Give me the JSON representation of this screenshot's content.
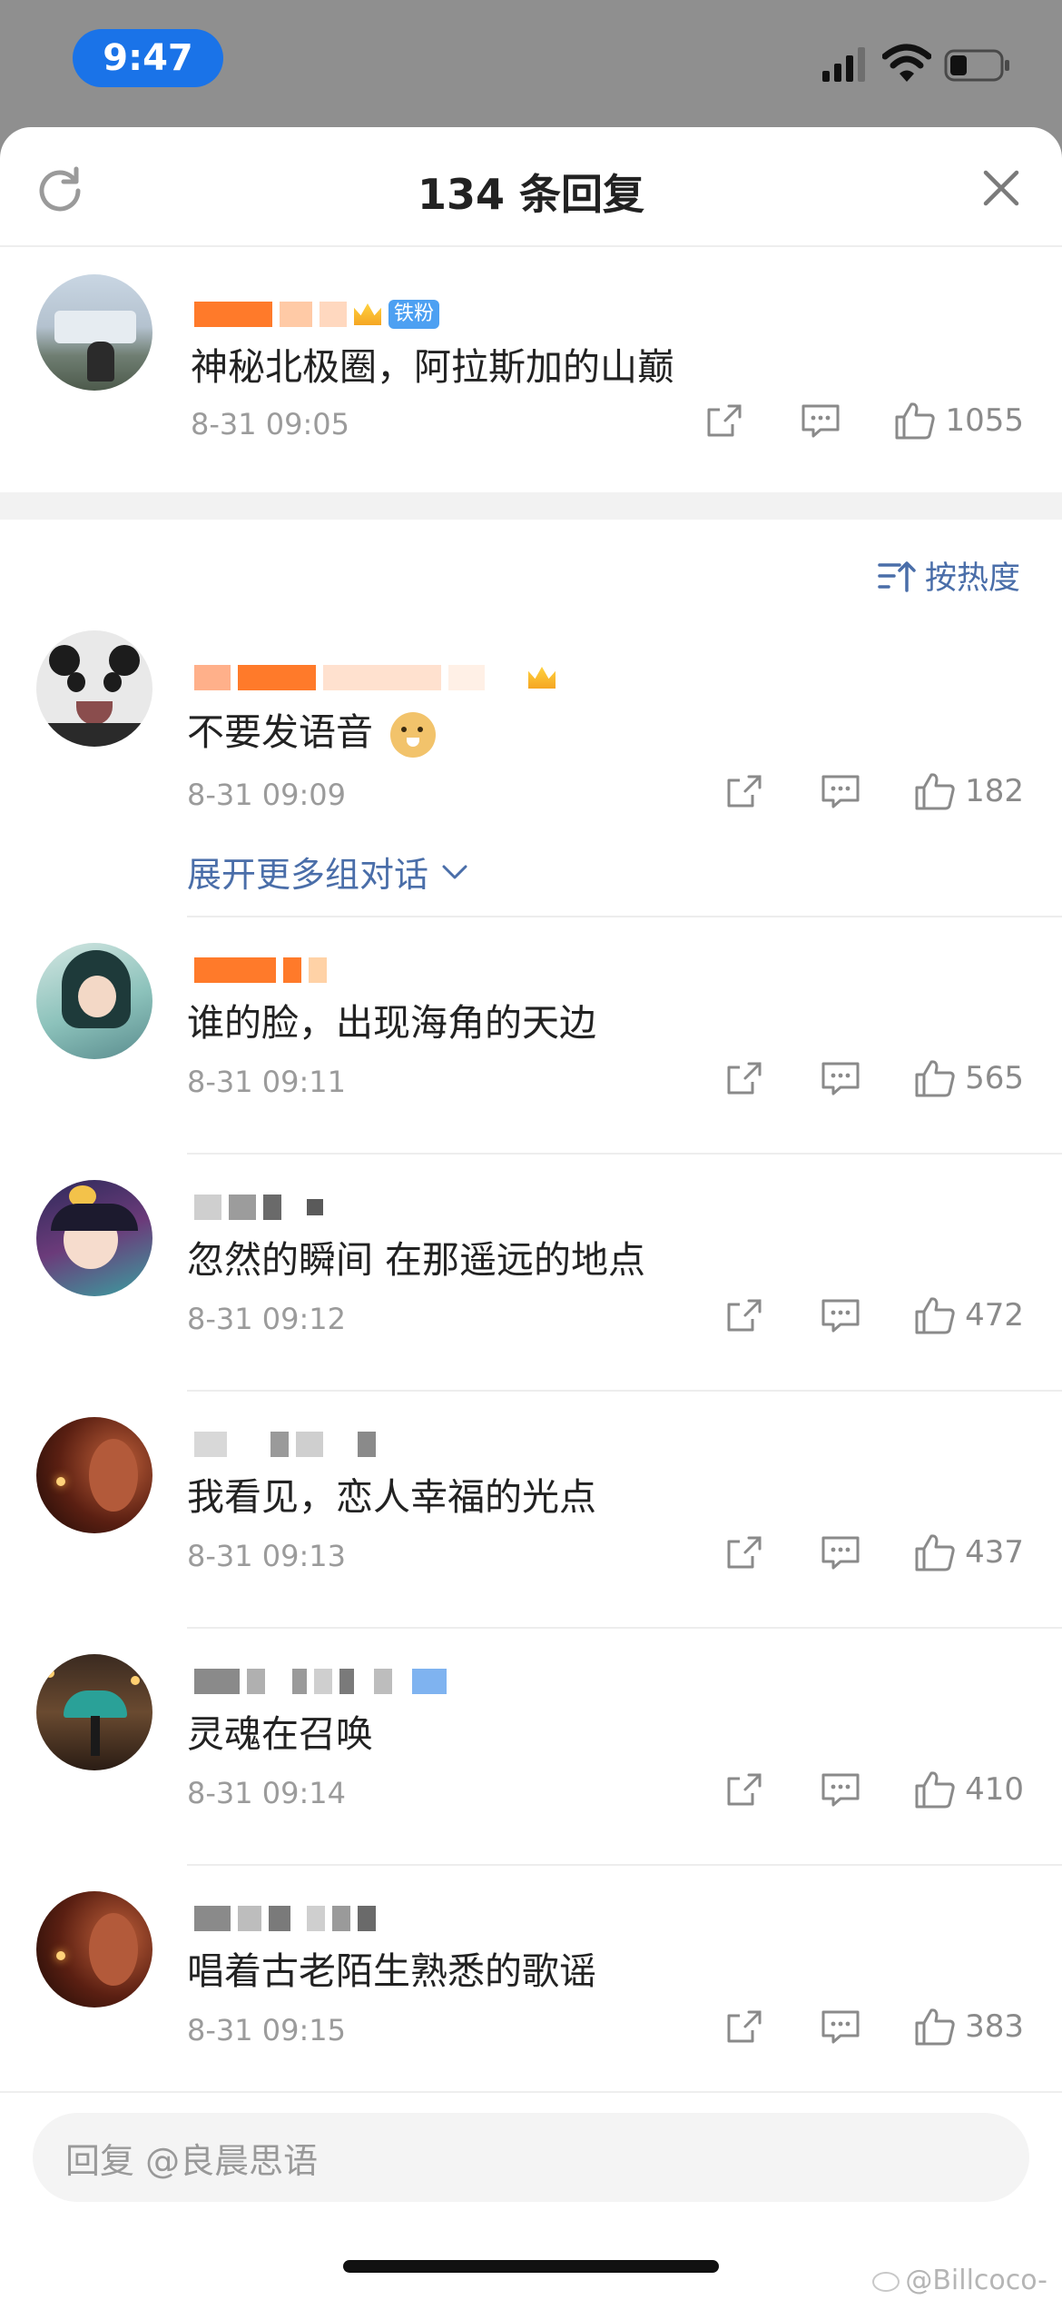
{
  "status_bar": {
    "time": "9:47"
  },
  "header": {
    "title": "134 条回复"
  },
  "main_comment": {
    "badge": "铁粉",
    "text": "神秘北极圈，阿拉斯加的山巅",
    "time": "8-31 09:05",
    "likes": "1055"
  },
  "sort": {
    "label": "按热度"
  },
  "replies": [
    {
      "text": "不要发语音",
      "time": "8-31 09:09",
      "likes": "182"
    },
    {
      "text": "谁的脸，出现海角的天边",
      "time": "8-31 09:11",
      "likes": "565"
    },
    {
      "text": "忽然的瞬间 在那遥远的地点",
      "time": "8-31 09:12",
      "likes": "472"
    },
    {
      "text": "我看见，恋人幸福的光点",
      "time": "8-31 09:13",
      "likes": "437"
    },
    {
      "text": "灵魂在召唤",
      "time": "8-31 09:14",
      "likes": "410"
    },
    {
      "text": "唱着古老陌生熟悉的歌谣",
      "time": "8-31 09:15",
      "likes": "383"
    }
  ],
  "expand": {
    "label": "展开更多组对话"
  },
  "input": {
    "placeholder": "回复 @良晨思语"
  },
  "watermark": "@Billcoco-",
  "icons": {
    "refresh": "refresh-icon",
    "close": "close-icon",
    "share": "share-icon",
    "comment": "comment-icon",
    "like": "thumbs-up-icon",
    "sort": "sort-icon",
    "chevron": "chevron-down-icon"
  },
  "colors": {
    "accent": "#4a6ea9",
    "time_pill": "#1a73e8",
    "badge": "#4da0f2"
  }
}
